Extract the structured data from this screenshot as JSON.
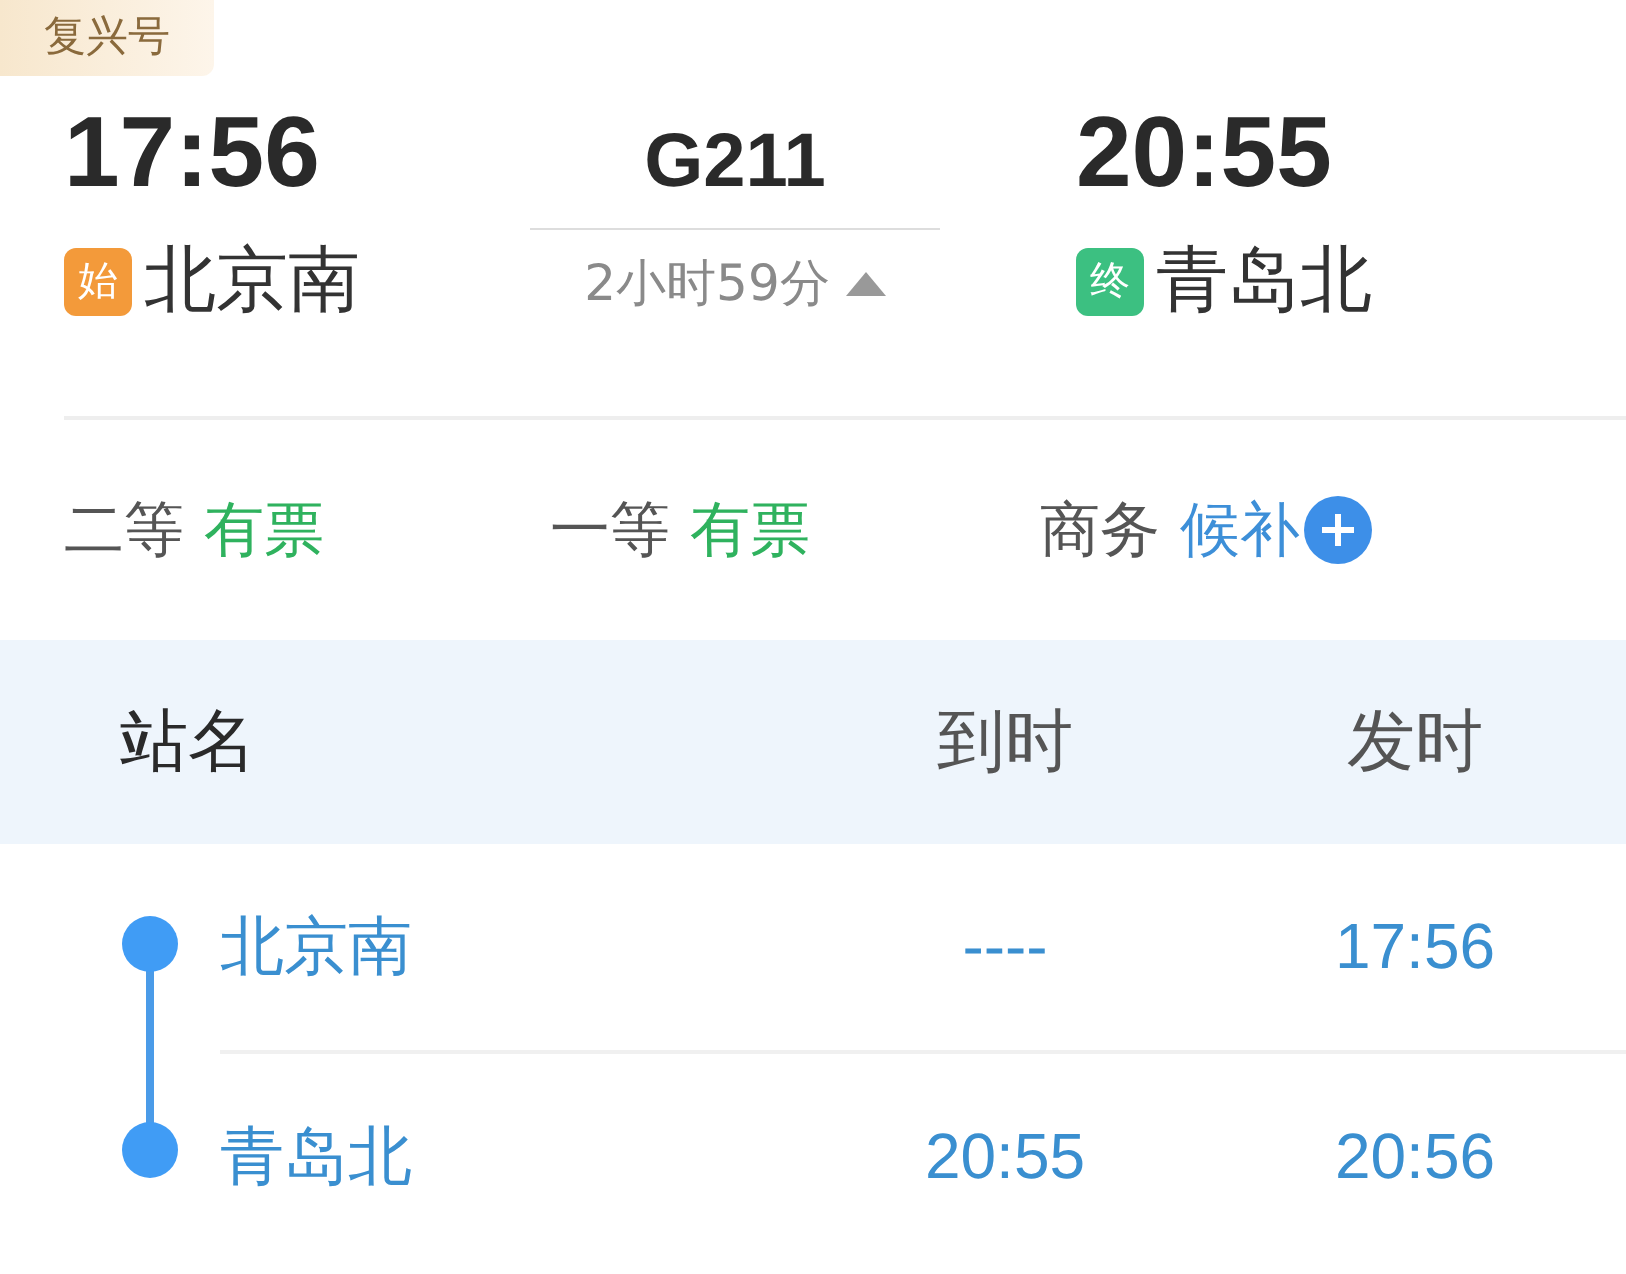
{
  "train_type": "复兴号",
  "departure": {
    "time": "17:56",
    "badge": "始",
    "station": "北京南"
  },
  "train": {
    "number": "G211",
    "duration": "2小时59分",
    "expanded": true
  },
  "arrival": {
    "time": "20:55",
    "badge": "终",
    "station": "青岛北"
  },
  "seats": [
    {
      "class": "二等",
      "status": "有票",
      "kind": "available"
    },
    {
      "class": "一等",
      "status": "有票",
      "kind": "available"
    },
    {
      "class": "商务",
      "status": "候补",
      "kind": "waitlist"
    }
  ],
  "stops_table": {
    "columns": [
      "站名",
      "到时",
      "发时"
    ],
    "rows": [
      {
        "station": "北京南",
        "arrive": "----",
        "depart": "17:56"
      },
      {
        "station": "青岛北",
        "arrive": "20:55",
        "depart": "20:56"
      }
    ]
  }
}
